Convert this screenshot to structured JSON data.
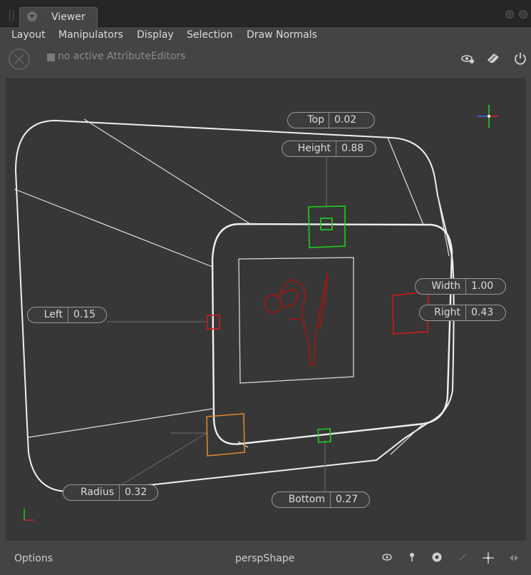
{
  "tab": {
    "title": "Viewer"
  },
  "menu": [
    "Layout",
    "Manipulators",
    "Display",
    "Selection",
    "Draw Normals"
  ],
  "toolbar": {
    "attribute_editor_status": "no active AttributeEditors",
    "icons": [
      "close-circle-icon",
      "visibility-settings-icon",
      "eraser-icon",
      "power-icon"
    ]
  },
  "viewport": {
    "parameters": {
      "top": {
        "label": "Top",
        "value": "0.02"
      },
      "height": {
        "label": "Height",
        "value": "0.88"
      },
      "width": {
        "label": "Width",
        "value": "1.00"
      },
      "right": {
        "label": "Right",
        "value": "0.43"
      },
      "left": {
        "label": "Left",
        "value": "0.15"
      },
      "bottom": {
        "label": "Bottom",
        "value": "0.27"
      },
      "radius": {
        "label": "Radius",
        "value": "0.32"
      }
    },
    "colors": {
      "background": "#373737",
      "wireframe": "#ffffff",
      "handle_vertical": "#1fd01f",
      "handle_horizontal": "#d01a1a",
      "handle_radius": "#d8892e",
      "texture": "#b01010"
    }
  },
  "status": {
    "options_label": "Options",
    "camera": "perspShape",
    "icons": [
      "eye-icon",
      "pin-icon",
      "camera-lens-icon",
      "select-arrow-icon",
      "move-icon",
      "orbit-icon"
    ]
  }
}
